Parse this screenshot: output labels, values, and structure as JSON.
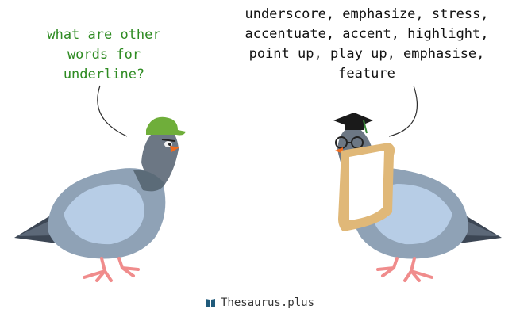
{
  "question": {
    "text": "what are other\nwords for\nunderline?",
    "color": "#2e8b22"
  },
  "answer": {
    "text": "underscore, emphasize, stress,\naccentuate, accent, highlight,\npoint up, play up, emphasise,\nfeature"
  },
  "footer": {
    "site": "Thesaurus.plus",
    "icon": "book-icon"
  },
  "colors": {
    "pigeon_body": "#8fa2b6",
    "pigeon_wing": "#b7cde6",
    "pigeon_head": "#6c7784",
    "beak": "#f06a1d",
    "feet": "#f08c8c",
    "green_cap": "#6fae3a",
    "bread_crust": "#e0b878",
    "bread_inside": "#f6ecd8"
  }
}
